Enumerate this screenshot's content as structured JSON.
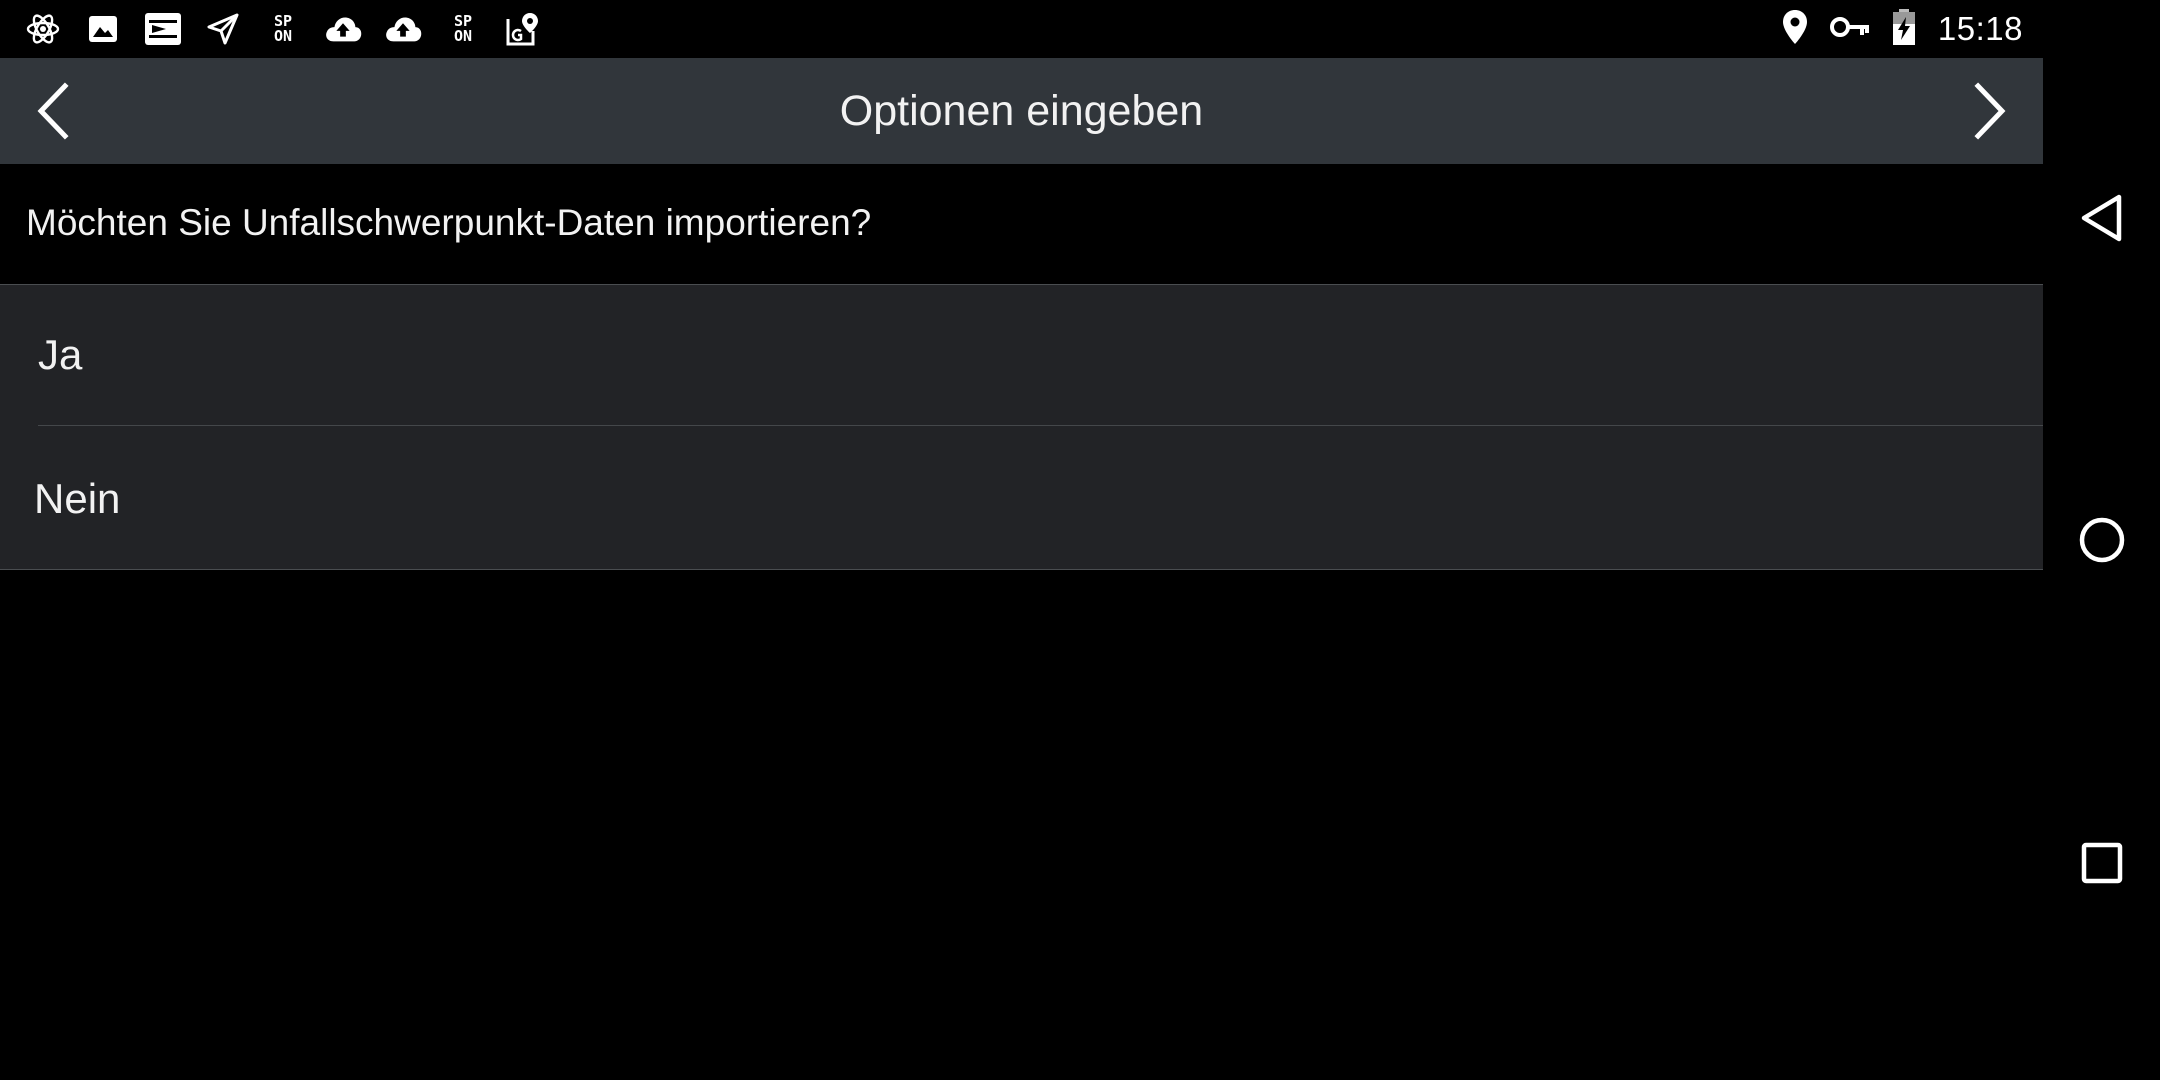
{
  "status_bar": {
    "left_icons": [
      "atom-icon",
      "image-icon",
      "input-icon",
      "send-icon",
      "sp-on-icon",
      "cloud-upload-icon",
      "cloud-upload-icon",
      "sp-on-icon",
      "map-pin-g-icon"
    ],
    "sp_on": {
      "line1": "SP",
      "line2": "ON"
    },
    "right_icons": [
      "location-icon",
      "vpn-key-icon",
      "battery-charging-icon"
    ],
    "time": "15:18"
  },
  "toolbar": {
    "title": "Optionen eingeben",
    "prev_icon": "chevron-left-icon",
    "next_icon": "chevron-right-icon"
  },
  "question": {
    "text": "Möchten Sie Unfallschwerpunkt-Daten importieren?"
  },
  "options": [
    {
      "label": "Ja"
    },
    {
      "label": "Nein"
    }
  ],
  "nav_bar": {
    "icons": [
      "back-triangle-icon",
      "home-circle-icon",
      "recents-square-icon"
    ]
  },
  "colors": {
    "toolbar_bg": "#31363b",
    "options_bg": "#222326",
    "background": "#000000",
    "text": "#f2f2f2"
  }
}
